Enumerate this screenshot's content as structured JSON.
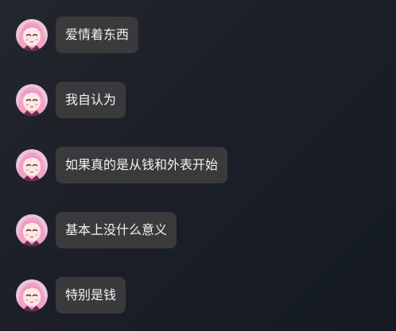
{
  "messages": [
    {
      "text": "爱情着东西"
    },
    {
      "text": "我自认为"
    },
    {
      "text": "如果真的是从钱和外表开始"
    },
    {
      "text": "基本上没什么意义"
    },
    {
      "text": "特别是钱"
    }
  ],
  "colors": {
    "bubble": "#3a3a3c",
    "text": "#f2f2f2",
    "avatar_hair": "#f2a2c8",
    "avatar_face": "#fde8e3",
    "avatar_outfit": "#6b2a4a"
  }
}
